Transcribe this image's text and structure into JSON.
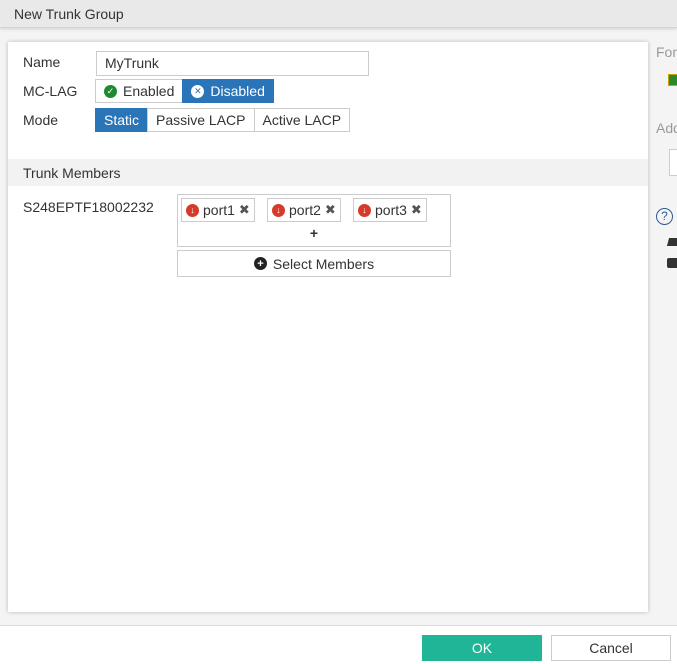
{
  "title": "New Trunk Group",
  "form": {
    "name_label": "Name",
    "name_value": "MyTrunk",
    "mclag_label": "MC-LAG",
    "mclag_options": [
      "Enabled",
      "Disabled"
    ],
    "mclag_selected": "Disabled",
    "mode_label": "Mode",
    "mode_options": [
      "Static",
      "Passive LACP",
      "Active LACP"
    ],
    "mode_selected": "Static"
  },
  "trunk_members": {
    "heading": "Trunk Members",
    "switch": "S248EPTF18002232",
    "ports": [
      "port1",
      "port2",
      "port3"
    ],
    "add": "+",
    "select_label": "Select Members"
  },
  "side": {
    "label1": "For",
    "label2": "Add",
    "help": "?"
  },
  "footer": {
    "ok": "OK",
    "cancel": "Cancel"
  },
  "colors": {
    "accent": "#2a74b8",
    "ok": "#1fb596"
  }
}
